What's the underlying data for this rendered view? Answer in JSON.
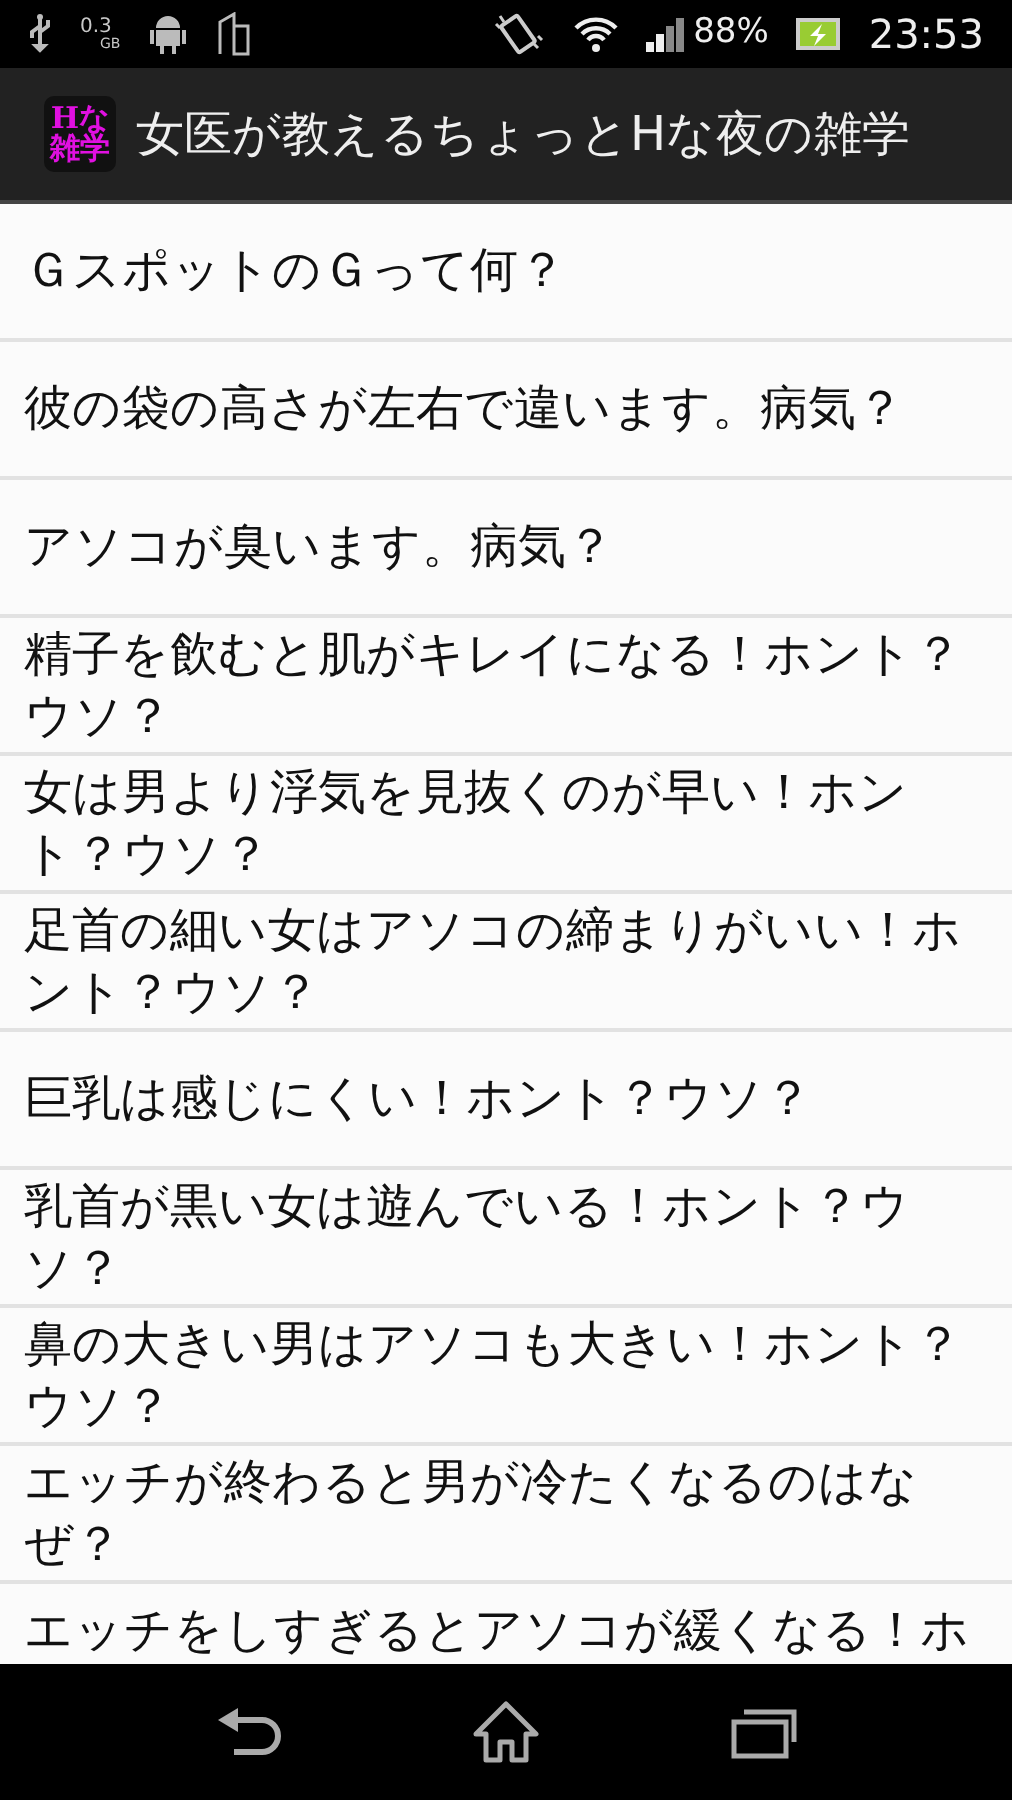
{
  "status_bar": {
    "storage": "0.3",
    "storage_unit": "GB",
    "battery": "88%",
    "time": "23:53"
  },
  "app_bar": {
    "icon_lines": [
      "Hな",
      "雑学"
    ],
    "title": "女医が教えるちょっとHな夜の雑学"
  },
  "list": [
    {
      "text": "ＧスポットのＧって何？"
    },
    {
      "text": "彼の袋の高さが左右で違います。病気？"
    },
    {
      "text": "アソコが臭います。病気？"
    },
    {
      "text": "精子を飲むと肌がキレイになる！ホント？ウソ？"
    },
    {
      "text": "女は男より浮気を見抜くのが早い！ホント？ウソ？"
    },
    {
      "text": "足首の細い女はアソコの締まりがいい！ホント？ウソ？"
    },
    {
      "text": "巨乳は感じにくい！ホント？ウソ？"
    },
    {
      "text": "乳首が黒い女は遊んでいる！ホント？ウソ？"
    },
    {
      "text": "鼻の大きい男はアソコも大きい！ホント？ウソ？"
    },
    {
      "text": "エッチが終わると男が冷たくなるのはなぜ？"
    },
    {
      "text": "エッチをしすぎるとアソコが緩くなる！ホ"
    }
  ]
}
